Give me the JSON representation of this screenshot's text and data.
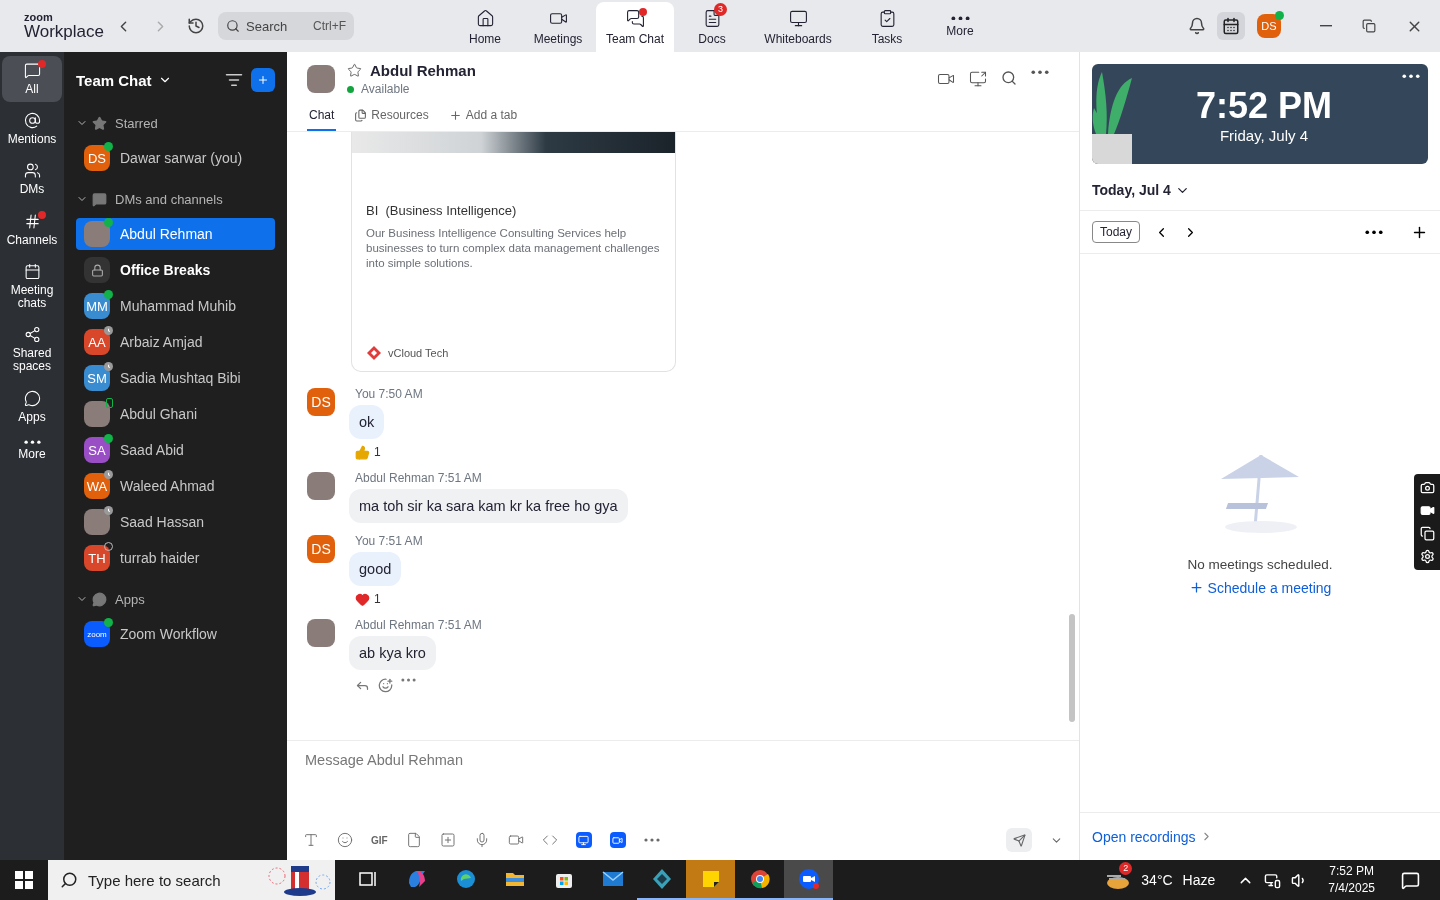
{
  "app": {
    "brand_small": "zoom",
    "brand": "Workplace"
  },
  "search": {
    "placeholder": "Search",
    "shortcut": "Ctrl+F"
  },
  "nav_tabs": [
    {
      "label": "Home",
      "selected": false,
      "dot": false
    },
    {
      "label": "Meetings",
      "selected": false,
      "dot": false
    },
    {
      "label": "Team Chat",
      "selected": true,
      "dot": true
    },
    {
      "label": "Docs",
      "selected": false,
      "dot": false,
      "badge": "3"
    },
    {
      "label": "Whiteboards",
      "selected": false,
      "dot": false
    },
    {
      "label": "Tasks",
      "selected": false,
      "dot": false
    },
    {
      "label": "More",
      "selected": false,
      "dot": false
    }
  ],
  "account": {
    "initials": "DS",
    "color": "#e0600c",
    "presence": {
      "kind": "online"
    }
  },
  "rail": [
    {
      "label": "All",
      "selected": true,
      "dot": true
    },
    {
      "label": "Mentions",
      "selected": false,
      "dot": false
    },
    {
      "label": "DMs",
      "selected": false,
      "dot": false
    },
    {
      "label": "Channels",
      "selected": false,
      "dot": true
    },
    {
      "label": "Meeting chats",
      "selected": false,
      "dot": false
    },
    {
      "label": "Shared spaces",
      "selected": false,
      "dot": false
    },
    {
      "label": "Apps",
      "selected": false,
      "dot": false
    },
    {
      "label": "More",
      "selected": false,
      "dot": false
    }
  ],
  "sidebar": {
    "title": "Team Chat",
    "sections": [
      {
        "title": "Starred",
        "expanded": true,
        "items": [
          {
            "name": "Dawar sarwar (you)",
            "kind": "initials",
            "initials": "DS",
            "color": "#e0600c",
            "presence": {
              "kind": "online"
            },
            "selected": false,
            "bold": false
          }
        ]
      },
      {
        "title": "DMs and channels",
        "expanded": true,
        "items": [
          {
            "name": "Abdul Rehman",
            "kind": "photo",
            "presence": {
              "kind": "online"
            },
            "selected": true,
            "bold": false
          },
          {
            "name": "Office Breaks",
            "kind": "channel",
            "selected": false,
            "bold": true
          },
          {
            "name": "Muhammad Muhib",
            "kind": "initials",
            "initials": "MM",
            "color": "#3a8cd0",
            "presence": {
              "kind": "online"
            },
            "selected": false,
            "bold": false
          },
          {
            "name": "Arbaiz Amjad",
            "kind": "initials",
            "initials": "AA",
            "color": "#d9472b",
            "presence": {
              "kind": "away"
            },
            "selected": false,
            "bold": false
          },
          {
            "name": "Sadia Mushtaq Bibi",
            "kind": "initials",
            "initials": "SM",
            "color": "#3a8cd0",
            "presence": {
              "kind": "away"
            },
            "selected": false,
            "bold": false
          },
          {
            "name": "Abdul Ghani",
            "kind": "photo",
            "presence": {
              "kind": "mobile"
            },
            "selected": false,
            "bold": false
          },
          {
            "name": "Saad Abid",
            "kind": "initials",
            "initials": "SA",
            "color": "#9a4ec6",
            "presence": {
              "kind": "online"
            },
            "selected": false,
            "bold": false
          },
          {
            "name": "Waleed Ahmad",
            "kind": "initials",
            "initials": "WA",
            "color": "#e0600c",
            "presence": {
              "kind": "away"
            },
            "selected": false,
            "bold": false
          },
          {
            "name": "Saad Hassan",
            "kind": "photo",
            "presence": {
              "kind": "away"
            },
            "selected": false,
            "bold": false
          },
          {
            "name": "turrab haider",
            "kind": "initials",
            "initials": "TH",
            "color": "#d9472b",
            "presence": {
              "kind": "offline"
            },
            "selected": false,
            "bold": false
          }
        ]
      },
      {
        "title": "Apps",
        "expanded": true,
        "items": [
          {
            "name": "Zoom Workflow",
            "kind": "app",
            "initials": "zoom",
            "color": "#0b5cff",
            "presence": {
              "kind": "online"
            },
            "selected": false,
            "bold": false
          }
        ]
      }
    ]
  },
  "chat": {
    "name": "Abdul Rehman",
    "presence": "Available",
    "starred": false,
    "tabs": [
      {
        "label": "Chat",
        "selected": true
      },
      {
        "label": "Resources",
        "selected": false
      }
    ],
    "add_tab": "Add a tab",
    "link_card": {
      "title": "BI  (Business Intelligence)",
      "description": "Our Business Intelligence Consulting Services help businesses to turn complex data management challenges into simple solutions.",
      "source": "vCloud Tech"
    },
    "messages": [
      {
        "mine": true,
        "sender": "You",
        "time": "7:50 AM",
        "initials": "DS",
        "color": "#e0600c",
        "text": "ok",
        "reaction": {
          "kind": "thumbs_up",
          "count": "1"
        }
      },
      {
        "mine": false,
        "sender": "Abdul Rehman",
        "time": "7:51 AM",
        "text": "ma toh sir ka sara kam kr ka free ho gya"
      },
      {
        "mine": true,
        "sender": "You",
        "time": "7:51 AM",
        "initials": "DS",
        "color": "#e0600c",
        "text": "good",
        "reaction": {
          "kind": "heart",
          "count": "1"
        }
      },
      {
        "mine": false,
        "sender": "Abdul Rehman",
        "time": "7:51 AM",
        "text": "ab kya kro",
        "actions": true
      }
    ],
    "composer": {
      "placeholder": "Message Abdul Rehman",
      "gif": "GIF"
    }
  },
  "calendar": {
    "time": "7:52 PM",
    "date": "Friday, July 4",
    "day": "Today, Jul 4",
    "today_button": "Today",
    "empty": "No meetings scheduled.",
    "schedule": "Schedule a meeting",
    "recordings": "Open recordings"
  },
  "taskbar": {
    "search_placeholder": "Type here to search",
    "apps": [
      {
        "kind": "task_view",
        "running": false,
        "focused": false,
        "flashing": false
      },
      {
        "kind": "copilot",
        "running": false,
        "focused": false,
        "flashing": false
      },
      {
        "kind": "edge",
        "running": false,
        "focused": false,
        "flashing": false
      },
      {
        "kind": "folder",
        "running": false,
        "focused": false,
        "flashing": false
      },
      {
        "kind": "store",
        "running": false,
        "focused": false,
        "flashing": false
      },
      {
        "kind": "mail",
        "running": false,
        "focused": false,
        "flashing": false
      },
      {
        "kind": "kite",
        "running": true,
        "focused": false,
        "flashing": false
      },
      {
        "kind": "sticky",
        "running": true,
        "focused": false,
        "flashing": true
      },
      {
        "kind": "chrome",
        "running": true,
        "focused": false,
        "flashing": false
      },
      {
        "kind": "zoom",
        "running": true,
        "focused": true,
        "flashing": false
      }
    ],
    "weather_badge": "2",
    "temperature": "34°C",
    "weather": "Haze",
    "time": "7:52 PM",
    "date": "7/4/2025"
  }
}
